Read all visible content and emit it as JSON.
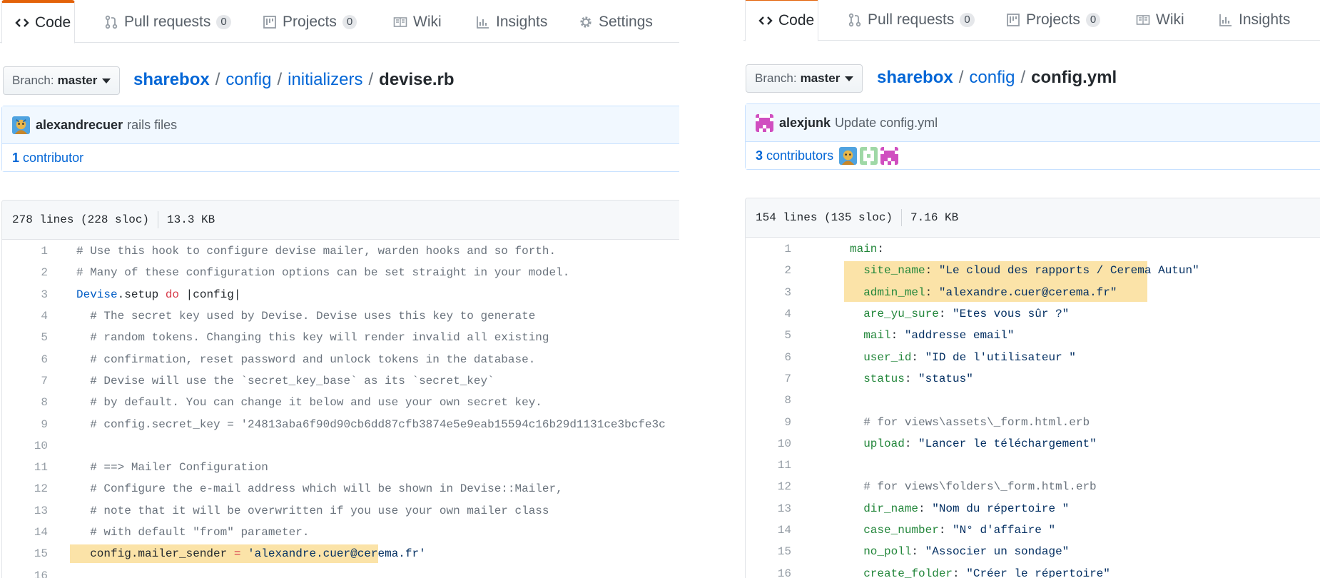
{
  "left": {
    "tabs": [
      {
        "label": "Code",
        "icon": "code-icon",
        "active": true
      },
      {
        "label": "Pull requests",
        "count": "0",
        "icon": "git-pull-request-icon"
      },
      {
        "label": "Projects",
        "count": "0",
        "icon": "project-icon"
      },
      {
        "label": "Wiki",
        "icon": "book-icon"
      },
      {
        "label": "Insights",
        "icon": "graph-icon"
      },
      {
        "label": "Settings",
        "icon": "gear-icon"
      }
    ],
    "branch": {
      "prefix": "Branch:",
      "name": "master"
    },
    "breadcrumb": {
      "repo": "sharebox",
      "parts": [
        "config",
        "initializers"
      ],
      "file": "devise.rb"
    },
    "commit": {
      "author": "alexandrecuer",
      "message": "rails files"
    },
    "contributors": {
      "count": "1",
      "label": "contributor"
    },
    "file_info": {
      "lines": "278 lines (228 sloc)",
      "size": "13.3 KB"
    },
    "code_lines": [
      {
        "n": "1",
        "text": "# Use this hook to configure devise mailer, warden hooks and so forth."
      },
      {
        "n": "2",
        "text": "# Many of these configuration options can be set straight in your model."
      },
      {
        "n": "3",
        "text": "Devise.setup do |config|"
      },
      {
        "n": "4",
        "text": "  # The secret key used by Devise. Devise uses this key to generate"
      },
      {
        "n": "5",
        "text": "  # random tokens. Changing this key will render invalid all existing"
      },
      {
        "n": "6",
        "text": "  # confirmation, reset password and unlock tokens in the database."
      },
      {
        "n": "7",
        "text": "  # Devise will use the `secret_key_base` as its `secret_key`"
      },
      {
        "n": "8",
        "text": "  # by default. You can change it below and use your own secret key."
      },
      {
        "n": "9",
        "text": "  # config.secret_key = '24813aba6f90d90cb6dd87cfb3874e5e9eab15594c16b29d1131ce3bcfe3c"
      },
      {
        "n": "10",
        "text": ""
      },
      {
        "n": "11",
        "text": "  # ==> Mailer Configuration"
      },
      {
        "n": "12",
        "text": "  # Configure the e-mail address which will be shown in Devise::Mailer,"
      },
      {
        "n": "13",
        "text": "  # note that it will be overwritten if you use your own mailer class"
      },
      {
        "n": "14",
        "text": "  # with default \"from\" parameter."
      },
      {
        "n": "15",
        "text": "  config.mailer_sender = 'alexandre.cuer@cerema.fr'"
      },
      {
        "n": "16",
        "text": ""
      }
    ]
  },
  "right": {
    "tabs": [
      {
        "label": "Code",
        "icon": "code-icon",
        "active": true
      },
      {
        "label": "Pull requests",
        "count": "0",
        "icon": "git-pull-request-icon"
      },
      {
        "label": "Projects",
        "count": "0",
        "icon": "project-icon"
      },
      {
        "label": "Wiki",
        "icon": "book-icon"
      },
      {
        "label": "Insights",
        "icon": "graph-icon"
      }
    ],
    "branch": {
      "prefix": "Branch:",
      "name": "master"
    },
    "breadcrumb": {
      "repo": "sharebox",
      "parts": [
        "config"
      ],
      "file": "config.yml"
    },
    "commit": {
      "author": "alexjunk",
      "message": "Update config.yml"
    },
    "contributors": {
      "count": "3",
      "label": "contributors"
    },
    "file_info": {
      "lines": "154 lines (135 sloc)",
      "size": "7.16 KB"
    },
    "code_lines": [
      {
        "n": "1",
        "text": "main:"
      },
      {
        "n": "2",
        "text": "  site_name: \"Le cloud des rapports / Cerema Autun\""
      },
      {
        "n": "3",
        "text": "  admin_mel: \"alexandre.cuer@cerema.fr\""
      },
      {
        "n": "4",
        "text": "  are_yu_sure: \"Etes vous sûr ?\""
      },
      {
        "n": "5",
        "text": "  mail: \"addresse email\""
      },
      {
        "n": "6",
        "text": "  user_id: \"ID de l'utilisateur \""
      },
      {
        "n": "7",
        "text": "  status: \"status\""
      },
      {
        "n": "8",
        "text": ""
      },
      {
        "n": "9",
        "text": "  # for views\\assets\\_form.html.erb"
      },
      {
        "n": "10",
        "text": "  upload: \"Lancer le téléchargement\""
      },
      {
        "n": "11",
        "text": ""
      },
      {
        "n": "12",
        "text": "  # for views\\folders\\_form.html.erb"
      },
      {
        "n": "13",
        "text": "  dir_name: \"Nom du répertoire \""
      },
      {
        "n": "14",
        "text": "  case_number: \"N° d'affaire \""
      },
      {
        "n": "15",
        "text": "  no_poll: \"Associer un sondage\""
      },
      {
        "n": "16",
        "text": "  create_folder: \"Créer le répertoire\""
      }
    ]
  },
  "colors": {
    "accent_tab": "#e36209",
    "link": "#0366d6",
    "highlight": "#fbe3a8",
    "commit_bg": "#f1f8ff"
  }
}
